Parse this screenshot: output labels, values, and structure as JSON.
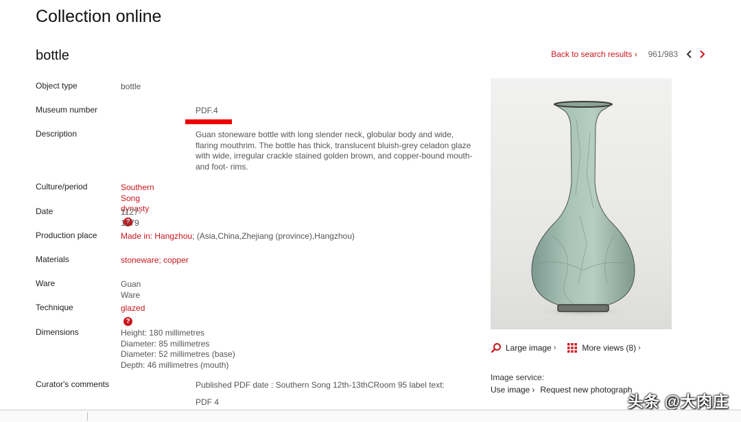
{
  "header": {
    "site_title": "Collection online"
  },
  "object": {
    "title": "bottle"
  },
  "nav": {
    "back_label": "Back to search results",
    "back_chevron": "›",
    "count": "961/983",
    "prev_icon": "chevron-left-icon",
    "next_icon": "chevron-right-icon"
  },
  "details": {
    "object_type": {
      "label": "Object type",
      "value": "bottle"
    },
    "museum_number": {
      "label": "Museum number",
      "value": "PDF.4"
    },
    "description": {
      "label": "Description",
      "value": "Guan stoneware bottle with long slender neck, globular body and wide, flaring mouthrim. The bottle has thick, translucent bluish-grey celadon glaze with wide, irregular crackle stained golden brown, and copper-bound mouth- and foot- rims."
    },
    "culture": {
      "label": "Culture/period",
      "value": "Southern Song dynasty",
      "help": "?"
    },
    "date": {
      "label": "Date",
      "value": "1127-1279"
    },
    "production": {
      "label": "Production place",
      "link": "Made in: Hangzhou",
      "rest": "; (Asia,China,Zhejiang (province),Hangzhou)"
    },
    "materials": {
      "label": "Materials",
      "link1": "stoneware",
      "sep": "; ",
      "link2": "copper"
    },
    "ware": {
      "label": "Ware",
      "value": "Guan Ware"
    },
    "technique": {
      "label": "Technique",
      "value": "glazed",
      "help": "?"
    },
    "dimensions": {
      "label": "Dimensions",
      "lines": [
        "Height: 180 millimetres",
        "Diameter: 85 millimetres",
        "Diameter: 52 millimetres (base)",
        "Depth: 46 millimetres (mouth)"
      ]
    },
    "curator": {
      "label": "Curator's comments",
      "line1": "Published PDF date : Southern Song 12th-13thCRoom 95 label text:",
      "line2": "PDF 4"
    }
  },
  "image_panel": {
    "large_image": "Large image",
    "more_views": "More views (8)",
    "chevron": "›",
    "service_label": "Image service:",
    "use_image": "Use image",
    "request_photo": "Request new photograph",
    "large_icon": "zoom-icon",
    "views_icon": "grid-icon",
    "highlight_color": "#ee0000",
    "accent_color": "#c8161d"
  },
  "watermark": "头条 @大肉庄"
}
